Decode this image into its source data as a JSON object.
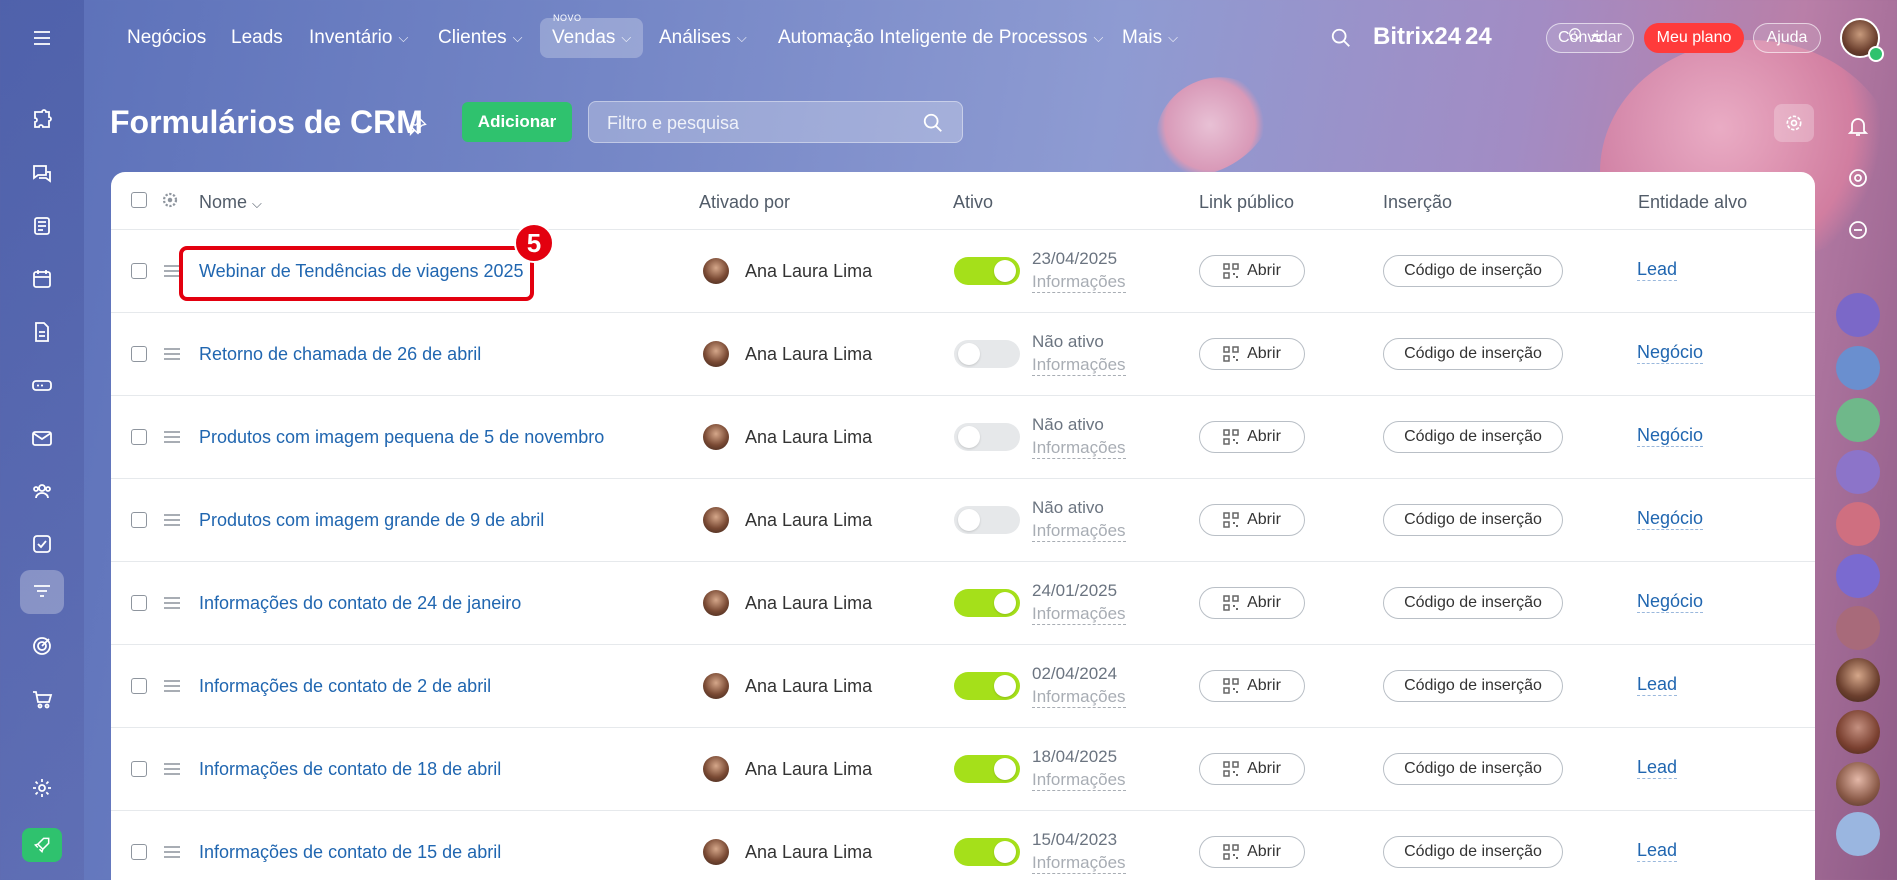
{
  "nav": {
    "items": [
      {
        "label": "Negócios",
        "chevron": false
      },
      {
        "label": "Leads",
        "chevron": false
      },
      {
        "label": "Inventário",
        "chevron": true
      },
      {
        "label": "Clientes",
        "chevron": true
      },
      {
        "label": "Vendas",
        "chevron": true,
        "active": true,
        "tag": "NOVO"
      },
      {
        "label": "Análises",
        "chevron": true
      },
      {
        "label": "Automação Inteligente de Processos",
        "chevron": true
      },
      {
        "label": "Mais",
        "chevron": true
      }
    ],
    "brand": "Bitrix24",
    "brand_suffix": "24",
    "invite_label": "Convidar",
    "plan_label": "Meu plano",
    "help_label": "Ajuda"
  },
  "page": {
    "title": "Formulários de CRM",
    "add_label": "Adicionar",
    "search_placeholder": "Filtro e pesquisa"
  },
  "table": {
    "headers": {
      "name": "Nome",
      "activated_by": "Ativado por",
      "active": "Ativo",
      "public_link": "Link público",
      "insertion": "Inserção",
      "target": "Entidade alvo"
    },
    "open_label": "Abrir",
    "embed_label": "Código de inserção",
    "info_label": "Informações",
    "rows": [
      {
        "name": "Webinar de Tendências de viagens 2025",
        "user": "Ana Laura Lima",
        "active": true,
        "status": "23/04/2025",
        "target": "Lead"
      },
      {
        "name": "Retorno de chamada de 26 de abril",
        "user": "Ana Laura Lima",
        "active": false,
        "status": "Não ativo",
        "target": "Negócio"
      },
      {
        "name": "Produtos com imagem pequena de 5 de novembro",
        "user": "Ana Laura Lima",
        "active": false,
        "status": "Não ativo",
        "target": "Negócio"
      },
      {
        "name": "Produtos com imagem grande de 9 de abril",
        "user": "Ana Laura Lima",
        "active": false,
        "status": "Não ativo",
        "target": "Negócio"
      },
      {
        "name": "Informações do contato de 24 de janeiro",
        "user": "Ana Laura Lima",
        "active": true,
        "status": "24/01/2025",
        "target": "Negócio"
      },
      {
        "name": "Informações de contato de 2 de abril",
        "user": "Ana Laura Lima",
        "active": true,
        "status": "02/04/2024",
        "target": "Lead"
      },
      {
        "name": "Informações de contato de 18 de abril",
        "user": "Ana Laura Lima",
        "active": true,
        "status": "18/04/2025",
        "target": "Lead"
      },
      {
        "name": "Informações de contato de 15 de abril",
        "user": "Ana Laura Lima",
        "active": true,
        "status": "15/04/2023",
        "target": "Lead"
      }
    ]
  },
  "annotation": {
    "badge": "5"
  },
  "colors": {
    "accent_green": "#2fc26e",
    "toggle_on": "#a5e01a",
    "link_blue": "#2066b0",
    "highlight_red": "#e3000f"
  }
}
